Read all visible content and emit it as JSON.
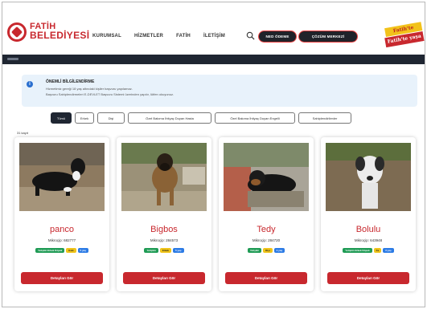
{
  "header": {
    "logo_line1": "FATİH",
    "logo_line2": "BELEDİYESİ",
    "nav": [
      "KURUMSAL",
      "HİZMETLER",
      "FATİH",
      "İLETİŞİM"
    ],
    "pill_buttons": [
      "NED ÖDEME",
      "ÇÖZÜM MERKEZİ"
    ],
    "badge_line1": "Fatih'te",
    "badge_line2": "Fatih'te yaşa"
  },
  "info": {
    "title": "ÖNEMLİ BİLGİLENDİRME",
    "lines": [
      "Hizmetimiz gereği 18 yaş altındaki kişiler başvuru yapılamaz.",
      "Başvuru Sahiplendirmeleri E-DEVLET Başvuru Sistemi üzerinden yapılır, lütfen okuyunuz."
    ]
  },
  "filters": [
    "Tümü",
    "Erkek",
    "Dişi",
    "Özel Bakıma İhtiyaç Duyan Hasta",
    "Özel Bakıma İhtiyaç Duyan Engelli",
    "Sahiplendirilenler"
  ],
  "count_text": "31 kayıt",
  "pets": [
    {
      "name": "panco",
      "id": "Mikroçip: 682777",
      "tags": [
        {
          "text": "Yetişkin Erkek Köpek",
          "color": "green"
        },
        {
          "text": "Eski",
          "color": "yellow"
        },
        {
          "text": "5 yaş",
          "color": "blue"
        }
      ],
      "button": "Detayları Gör"
    },
    {
      "name": "Bigbos",
      "id": "Mikroçip: 284573",
      "tags": [
        {
          "text": "Yetişkin",
          "color": "green"
        },
        {
          "text": "Erkek",
          "color": "yellow"
        },
        {
          "text": "5 yaş",
          "color": "blue"
        }
      ],
      "button": "Detayları Gör"
    },
    {
      "name": "Tedy",
      "id": "Mikroçip: 284720",
      "tags": [
        {
          "text": "Yetişkin",
          "color": "green"
        },
        {
          "text": "Dişi",
          "color": "yellow"
        },
        {
          "text": "4 yaş",
          "color": "blue"
        }
      ],
      "button": "Detayları Gör"
    },
    {
      "name": "Bolulu",
      "id": "Mikroçip: 643948",
      "tags": [
        {
          "text": "Yetişkin Erkek Köpek",
          "color": "green"
        },
        {
          "text": "Fa",
          "color": "yellow"
        },
        {
          "text": "3 yaş",
          "color": "blue"
        }
      ],
      "button": "Detayları Gör"
    }
  ],
  "colors": {
    "brand": "#c8282e",
    "dark": "#1f2632",
    "info_bg": "#e8f2fb"
  }
}
